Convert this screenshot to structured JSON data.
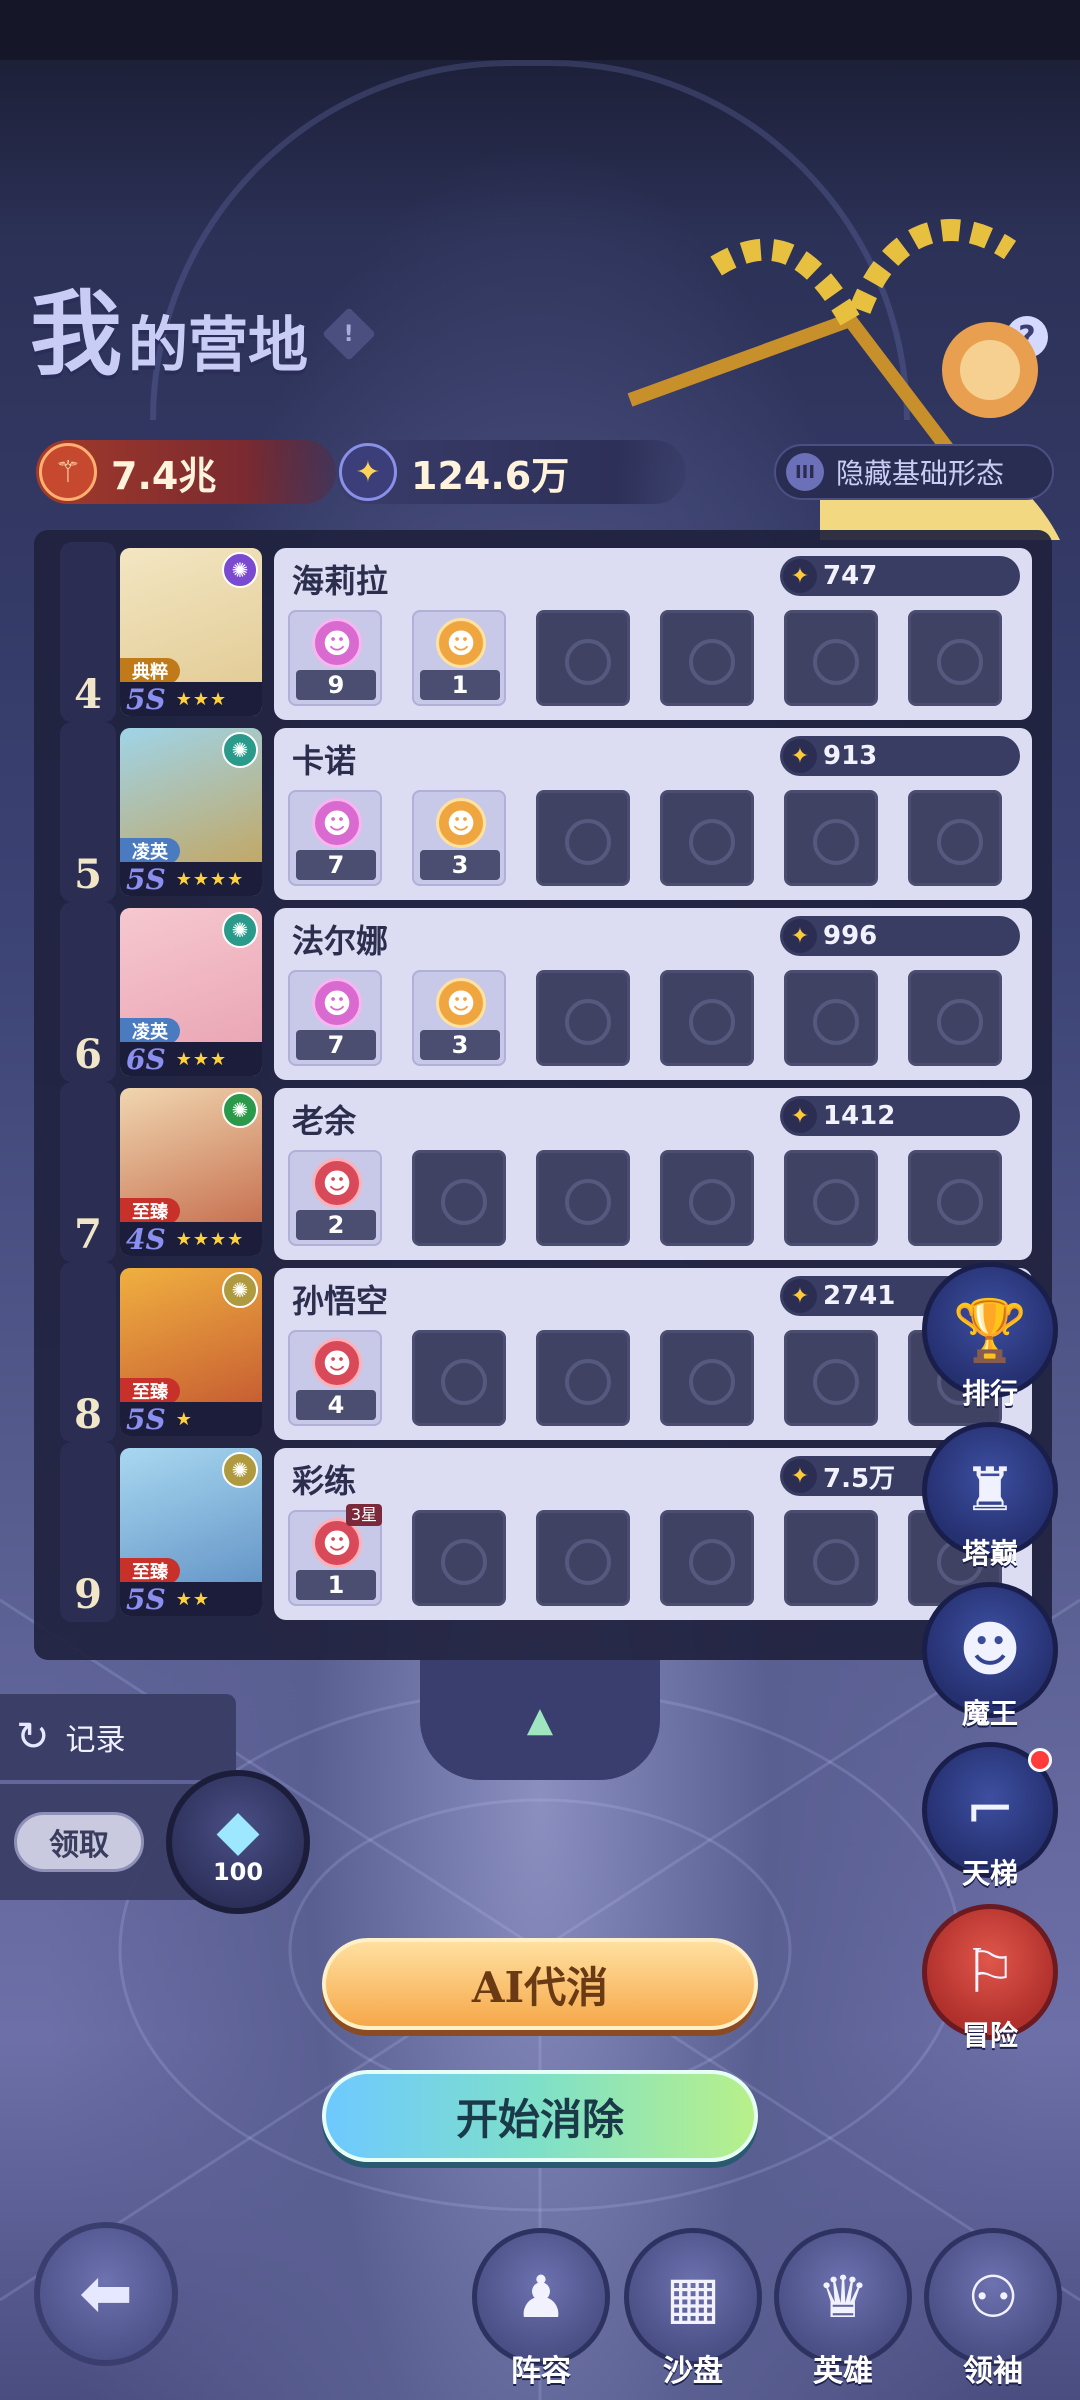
{
  "header": {
    "title_big": "我",
    "title_rest": "的营地",
    "info_glyph": "!",
    "help_glyph": "?"
  },
  "stats": {
    "power": "7.4兆",
    "gold": "124.6万",
    "hide_toggle_label": "隐藏基础形态"
  },
  "heroes": [
    {
      "rank": "4",
      "name": "海莉拉",
      "power": "747",
      "tag": "典粹",
      "tag_color": "#c07a1a",
      "level": "5S",
      "stars": "★★★",
      "element_color": "#7a4ad0",
      "portrait_colors": [
        "#f3e6c2",
        "#e0c890"
      ],
      "slots": [
        {
          "type": "item",
          "mask": "pink",
          "count": "9"
        },
        {
          "type": "item",
          "mask": "gold",
          "count": "1"
        },
        {
          "type": "empty"
        },
        {
          "type": "empty"
        },
        {
          "type": "empty"
        },
        {
          "type": "empty"
        }
      ]
    },
    {
      "rank": "5",
      "name": "卡诺",
      "power": "913",
      "tag": "凌英",
      "tag_color": "#4a7ac0",
      "level": "5S",
      "stars": "★★★★",
      "element_color": "#2a9a8a",
      "portrait_colors": [
        "#9fd4e8",
        "#c8a050"
      ],
      "slots": [
        {
          "type": "item",
          "mask": "pink",
          "count": "7"
        },
        {
          "type": "item",
          "mask": "gold",
          "count": "3"
        },
        {
          "type": "empty"
        },
        {
          "type": "empty"
        },
        {
          "type": "empty"
        },
        {
          "type": "empty"
        }
      ]
    },
    {
      "rank": "6",
      "name": "法尔娜",
      "power": "996",
      "tag": "凌英",
      "tag_color": "#4a7ac0",
      "level": "6S",
      "stars": "★★★",
      "element_color": "#2a9a8a",
      "portrait_colors": [
        "#f6c8d0",
        "#e8a0b0"
      ],
      "slots": [
        {
          "type": "item",
          "mask": "pink",
          "count": "7"
        },
        {
          "type": "item",
          "mask": "gold",
          "count": "3"
        },
        {
          "type": "empty"
        },
        {
          "type": "empty"
        },
        {
          "type": "empty"
        },
        {
          "type": "empty"
        }
      ]
    },
    {
      "rank": "7",
      "name": "老余",
      "power": "1412",
      "tag": "至臻",
      "tag_color": "#c8302a",
      "level": "4S",
      "stars": "★★★★",
      "element_color": "#2a9a4a",
      "portrait_colors": [
        "#f0d6b0",
        "#c06040"
      ],
      "slots": [
        {
          "type": "item",
          "mask": "red",
          "count": "2"
        },
        {
          "type": "empty"
        },
        {
          "type": "empty"
        },
        {
          "type": "empty"
        },
        {
          "type": "empty"
        },
        {
          "type": "empty"
        }
      ]
    },
    {
      "rank": "8",
      "name": "孙悟空",
      "power": "2741",
      "tag": "至臻",
      "tag_color": "#c8302a",
      "level": "5S",
      "stars": "★",
      "element_color": "#b09a40",
      "portrait_colors": [
        "#f0b040",
        "#c05030"
      ],
      "slots": [
        {
          "type": "item",
          "mask": "red",
          "count": "4"
        },
        {
          "type": "empty"
        },
        {
          "type": "empty"
        },
        {
          "type": "empty"
        },
        {
          "type": "empty"
        },
        {
          "type": "empty"
        }
      ]
    },
    {
      "rank": "9",
      "name": "彩练",
      "power": "7.5万",
      "tag": "至臻",
      "tag_color": "#c8302a",
      "level": "5S",
      "stars": "★★",
      "element_color": "#b09a40",
      "portrait_colors": [
        "#a8d8f0",
        "#5a8ac0"
      ],
      "slots": [
        {
          "type": "item",
          "mask": "red",
          "count": "1",
          "badge": "3星"
        },
        {
          "type": "empty"
        },
        {
          "type": "empty"
        },
        {
          "type": "empty"
        },
        {
          "type": "empty"
        },
        {
          "type": "empty"
        }
      ]
    }
  ],
  "side_menu": [
    {
      "label": "排行",
      "icon": "trophy-icon",
      "glyph": "🏆"
    },
    {
      "label": "塔巅",
      "icon": "tower-icon",
      "glyph": "♜"
    },
    {
      "label": "魔王",
      "icon": "demon-cat-icon",
      "glyph": "☻"
    },
    {
      "label": "天梯",
      "icon": "ladder-icon",
      "glyph": "⌐"
    },
    {
      "label": "冒险",
      "icon": "map-pin-icon",
      "glyph": "⚐"
    }
  ],
  "record": {
    "label": "记录"
  },
  "claim": {
    "label": "领取",
    "gem_count": "100"
  },
  "actions": {
    "ai_label": "AI代消",
    "start_label": "开始消除"
  },
  "bottom_nav": [
    {
      "label": "阵容",
      "icon": "lineup-icon",
      "glyph": "♟"
    },
    {
      "label": "沙盘",
      "icon": "sandbox-grid-icon",
      "glyph": "▦"
    },
    {
      "label": "英雄",
      "icon": "hero-icon",
      "glyph": "♛"
    },
    {
      "label": "领袖",
      "icon": "medal-icon",
      "glyph": "⚇"
    }
  ],
  "colors": {
    "card_bg": "#dcdcf2",
    "rank_bg": "#2b2e52",
    "power_orange": "#c6482e",
    "gold_accent": "#ffd25a",
    "mask_pink": "#d96ad0",
    "mask_gold": "#f0a640",
    "mask_red": "#d84a5a"
  }
}
